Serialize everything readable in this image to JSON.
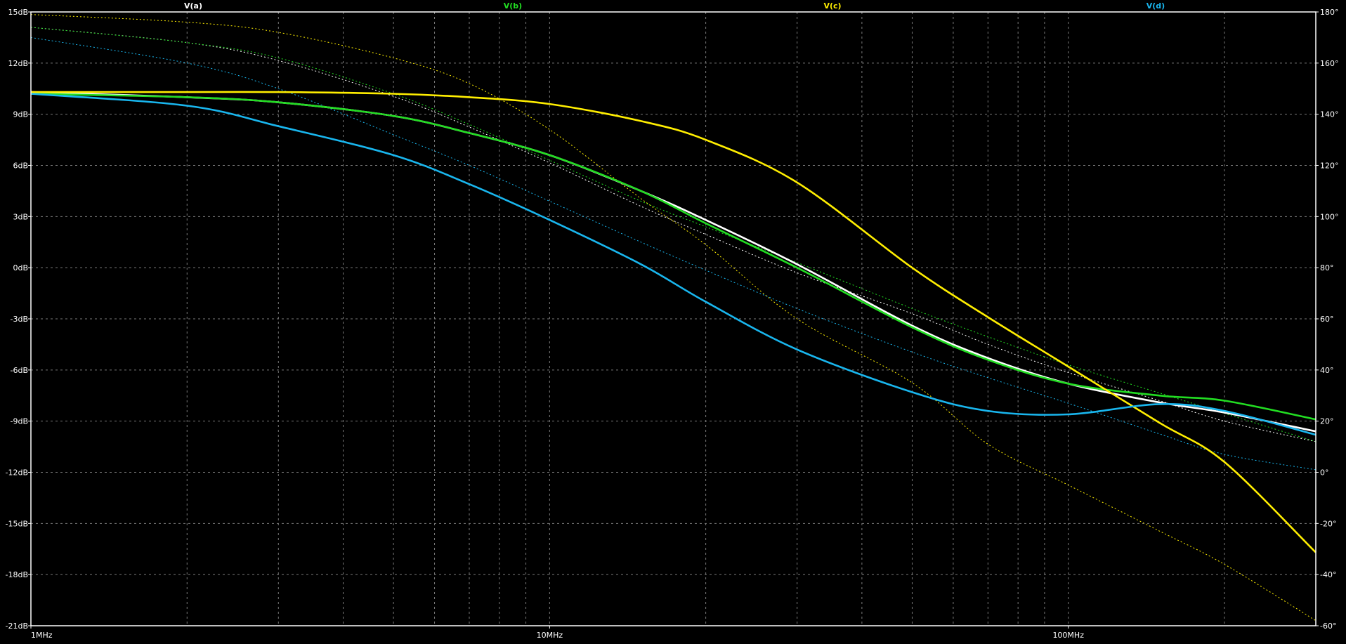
{
  "chart_data": {
    "type": "line",
    "title": "",
    "background": "#000000",
    "grid": true,
    "grid_color": "#7a7a7a",
    "frame_color": "#ffffff",
    "legend_placement": "top",
    "x_axis": {
      "scale": "log",
      "range_hz": [
        1000000,
        300000000
      ],
      "tick_labels": [
        {
          "value": 1000000,
          "label": "1MHz"
        },
        {
          "value": 10000000,
          "label": "10MHz"
        },
        {
          "value": 100000000,
          "label": "100MHz"
        }
      ]
    },
    "y_left": {
      "unit": "dB",
      "range": [
        -21,
        15
      ],
      "ticks": [
        {
          "value": 15,
          "label": "15dB"
        },
        {
          "value": 12,
          "label": "12dB"
        },
        {
          "value": 9,
          "label": "9dB"
        },
        {
          "value": 6,
          "label": "6dB"
        },
        {
          "value": 3,
          "label": "3dB"
        },
        {
          "value": 0,
          "label": "0dB"
        },
        {
          "value": -3,
          "label": "-3dB"
        },
        {
          "value": -6,
          "label": "-6dB"
        },
        {
          "value": -9,
          "label": "-9dB"
        },
        {
          "value": -12,
          "label": "-12dB"
        },
        {
          "value": -15,
          "label": "-15dB"
        },
        {
          "value": -18,
          "label": "-18dB"
        },
        {
          "value": -21,
          "label": "-21dB"
        }
      ]
    },
    "y_right": {
      "unit": "degrees",
      "range": [
        -60,
        180
      ],
      "ticks": [
        {
          "value": 180,
          "label": "180°"
        },
        {
          "value": 160,
          "label": "160°"
        },
        {
          "value": 140,
          "label": "140°"
        },
        {
          "value": 120,
          "label": "120°"
        },
        {
          "value": 100,
          "label": "100°"
        },
        {
          "value": 80,
          "label": "80°"
        },
        {
          "value": 60,
          "label": "60°"
        },
        {
          "value": 40,
          "label": "40°"
        },
        {
          "value": 20,
          "label": "20°"
        },
        {
          "value": 0,
          "label": "0°"
        },
        {
          "value": -20,
          "label": "-20°"
        },
        {
          "value": -40,
          "label": "-40°"
        },
        {
          "value": -60,
          "label": "-60°"
        }
      ]
    },
    "series": [
      {
        "name": "V(a)",
        "color": "#ffffff",
        "x_hz": [
          1000000,
          2000000,
          3000000,
          5000000,
          7000000,
          10000000,
          15000000,
          20000000,
          30000000,
          50000000,
          70000000,
          100000000,
          150000000,
          200000000,
          300000000
        ],
        "magnitude_db": [
          10.3,
          10.0,
          9.7,
          8.9,
          7.9,
          6.6,
          4.5,
          2.8,
          0.2,
          -3.4,
          -5.3,
          -6.8,
          -7.9,
          -8.5,
          -9.6
        ],
        "phase_deg": [
          174,
          168,
          161,
          147,
          135,
          121,
          104,
          93,
          78,
          62,
          50,
          39,
          28,
          20,
          12
        ]
      },
      {
        "name": "V(b)",
        "color": "#22dd22",
        "x_hz": [
          1000000,
          2000000,
          3000000,
          5000000,
          7000000,
          10000000,
          15000000,
          20000000,
          30000000,
          50000000,
          70000000,
          100000000,
          150000000,
          200000000,
          300000000
        ],
        "magnitude_db": [
          10.2,
          10.0,
          9.7,
          8.9,
          7.9,
          6.6,
          4.5,
          2.6,
          0.0,
          -3.5,
          -5.4,
          -6.8,
          -7.5,
          -7.8,
          -8.9
        ],
        "phase_deg": [
          174,
          168,
          162,
          148,
          136,
          122,
          106,
          96,
          82,
          64,
          53,
          42,
          31,
          23,
          12
        ]
      },
      {
        "name": "V(c)",
        "color": "#ffee00",
        "x_hz": [
          1000000,
          2000000,
          3000000,
          5000000,
          7000000,
          10000000,
          15000000,
          20000000,
          30000000,
          50000000,
          70000000,
          100000000,
          150000000,
          200000000,
          300000000
        ],
        "magnitude_db": [
          10.3,
          10.3,
          10.3,
          10.2,
          10.0,
          9.6,
          8.6,
          7.5,
          5.0,
          0.0,
          -2.9,
          -5.8,
          -9.1,
          -11.4,
          -16.7
        ],
        "phase_deg": [
          179,
          176,
          172,
          162,
          152,
          134,
          107,
          89,
          60,
          35,
          11,
          -5,
          -23,
          -36,
          -58
        ]
      },
      {
        "name": "V(d)",
        "color": "#19b6ee",
        "x_hz": [
          1000000,
          2000000,
          3000000,
          5000000,
          7000000,
          10000000,
          15000000,
          20000000,
          30000000,
          50000000,
          70000000,
          100000000,
          150000000,
          200000000,
          300000000
        ],
        "magnitude_db": [
          10.2,
          9.5,
          8.3,
          6.6,
          4.9,
          2.8,
          0.2,
          -2.0,
          -4.8,
          -7.3,
          -8.4,
          -8.6,
          -8.0,
          -8.4,
          -9.8
        ],
        "phase_deg": [
          170,
          160,
          150,
          132,
          120,
          106,
          90,
          79,
          64,
          47,
          37,
          27,
          15,
          7,
          1
        ]
      }
    ]
  }
}
